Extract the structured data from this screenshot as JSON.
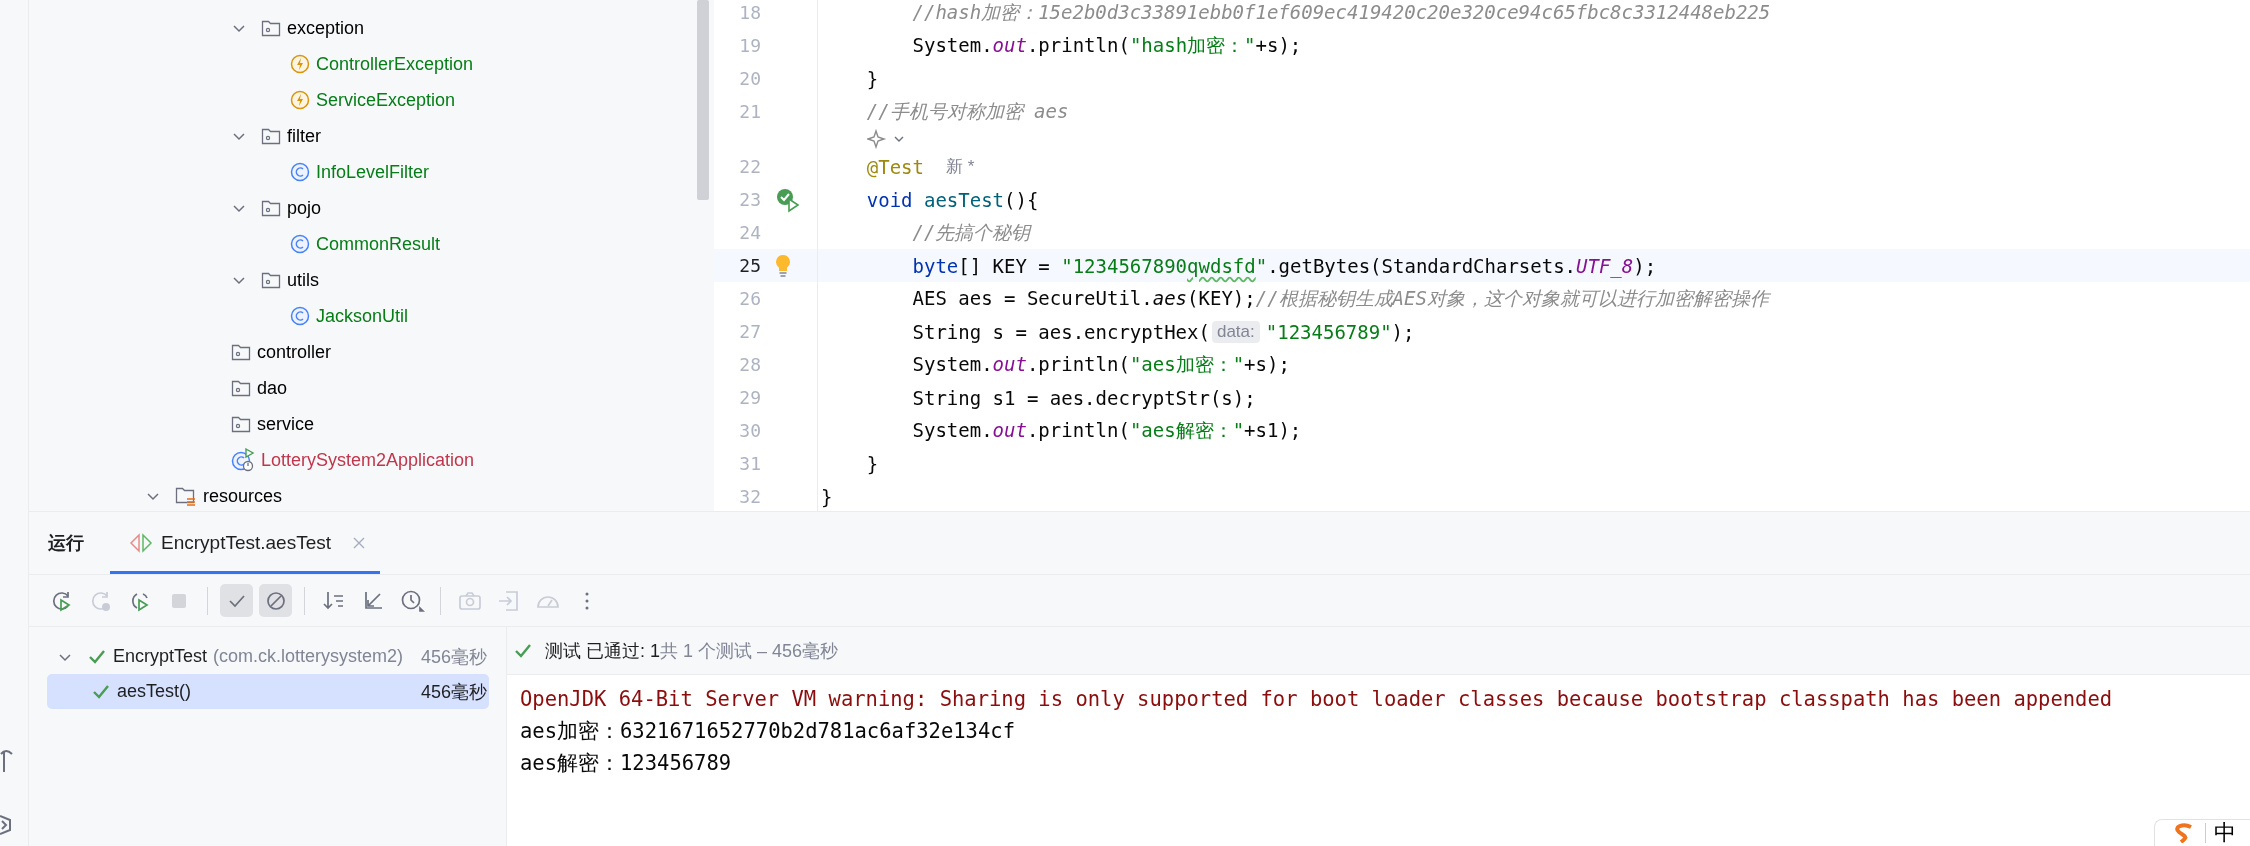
{
  "project_tree": {
    "items": [
      {
        "label": "exception",
        "kind": "package",
        "expanded": true,
        "children": [
          {
            "label": "ControllerException",
            "kind": "exception",
            "color": "#067d17"
          },
          {
            "label": "ServiceException",
            "kind": "exception",
            "color": "#067d17"
          }
        ]
      },
      {
        "label": "filter",
        "kind": "package",
        "expanded": true,
        "children": [
          {
            "label": "InfoLevelFilter",
            "kind": "class",
            "color": "#067d17"
          }
        ]
      },
      {
        "label": "pojo",
        "kind": "package",
        "expanded": true,
        "children": [
          {
            "label": "CommonResult",
            "kind": "class",
            "color": "#067d17"
          }
        ]
      },
      {
        "label": "utils",
        "kind": "package",
        "expanded": true,
        "children": [
          {
            "label": "JacksonUtil",
            "kind": "class",
            "color": "#067d17"
          }
        ]
      },
      {
        "label": "controller",
        "kind": "package"
      },
      {
        "label": "dao",
        "kind": "package"
      },
      {
        "label": "service",
        "kind": "package"
      },
      {
        "label": "LotterySystem2Application",
        "kind": "application",
        "color": "#c0364c"
      }
    ],
    "outer_items": [
      {
        "label": "resources",
        "kind": "resources",
        "expanded": true
      }
    ]
  },
  "editor": {
    "lines": [
      {
        "kind": "code",
        "number": "18",
        "current": false,
        "tokens": [
          {
            "text": "        //hash加密：15e2b0d3c33891ebb0f1ef609ec419420c20e320ce94c65fbc8c3312448eb225",
            "kind": "comment"
          }
        ]
      },
      {
        "kind": "code",
        "number": "19",
        "current": false,
        "tokens": [
          {
            "text": "        System.",
            "kind": "plain"
          },
          {
            "text": "out",
            "kind": "field"
          },
          {
            "text": ".println(",
            "kind": "plain"
          },
          {
            "text": "\"hash加密：\"",
            "kind": "string"
          },
          {
            "text": "+s);",
            "kind": "plain"
          }
        ]
      },
      {
        "kind": "code",
        "number": "20",
        "current": false,
        "tokens": [
          {
            "text": "    }",
            "kind": "plain"
          }
        ]
      },
      {
        "kind": "code",
        "number": "21",
        "current": false,
        "tokens": [
          {
            "text": "    //手机号对称加密 aes",
            "kind": "comment"
          }
        ]
      },
      {
        "kind": "ai_hint"
      },
      {
        "kind": "code",
        "number": "22",
        "current": false,
        "tokens": [
          {
            "text": "    @Test",
            "kind": "annotation"
          },
          {
            "text": "新 *",
            "kind": "author_hint"
          }
        ]
      },
      {
        "kind": "code",
        "number": "23",
        "current": false,
        "run_button": true,
        "bulb": false,
        "tokens": [
          {
            "text": "    void",
            "kind": "keyword"
          },
          {
            "text": " aesTest",
            "kind": "declaration"
          },
          {
            "text": "(){",
            "kind": "plain"
          }
        ]
      },
      {
        "kind": "code",
        "number": "24",
        "current": false,
        "tokens": [
          {
            "text": "        //先搞个秘钥",
            "kind": "comment"
          }
        ]
      },
      {
        "kind": "code",
        "number": "25",
        "current": true,
        "run_button": false,
        "bulb": true,
        "tokens": [
          {
            "text": "        byte",
            "kind": "keyword"
          },
          {
            "text": "[] KEY = ",
            "kind": "plain"
          },
          {
            "text": "\"1234567890",
            "kind": "string"
          },
          {
            "text": "qwdsfd",
            "kind": "string",
            "typo": true
          },
          {
            "text": "\"",
            "kind": "string"
          },
          {
            "text": ".getBytes(StandardCharsets.",
            "kind": "plain"
          },
          {
            "text": "UTF_8",
            "kind": "field"
          },
          {
            "text": ");",
            "kind": "plain"
          }
        ]
      },
      {
        "kind": "code",
        "number": "26",
        "current": false,
        "tokens": [
          {
            "text": "        AES aes = SecureUtil.",
            "kind": "plain"
          },
          {
            "text": "aes",
            "kind": "static"
          },
          {
            "text": "(KEY);",
            "kind": "plain"
          },
          {
            "text": "//根据秘钥生成AES对象，这个对象就可以进行加密解密操作",
            "kind": "comment"
          }
        ]
      },
      {
        "kind": "code",
        "number": "27",
        "current": false,
        "tokens": [
          {
            "text": "        String s = aes.encryptHex(",
            "kind": "plain"
          },
          {
            "text": "data:",
            "kind": "param_hint"
          },
          {
            "text": "\"123456789\"",
            "kind": "string"
          },
          {
            "text": ");",
            "kind": "plain"
          }
        ]
      },
      {
        "kind": "code",
        "number": "28",
        "current": false,
        "tokens": [
          {
            "text": "        System.",
            "kind": "plain"
          },
          {
            "text": "out",
            "kind": "field"
          },
          {
            "text": ".println(",
            "kind": "plain"
          },
          {
            "text": "\"aes加密：\"",
            "kind": "string"
          },
          {
            "text": "+s);",
            "kind": "plain"
          }
        ]
      },
      {
        "kind": "code",
        "number": "29",
        "current": false,
        "tokens": [
          {
            "text": "        String s1 = aes.decryptStr(s);",
            "kind": "plain"
          }
        ]
      },
      {
        "kind": "code",
        "number": "30",
        "current": false,
        "tokens": [
          {
            "text": "        System.",
            "kind": "plain"
          },
          {
            "text": "out",
            "kind": "field"
          },
          {
            "text": ".println(",
            "kind": "plain"
          },
          {
            "text": "\"aes解密：\"",
            "kind": "string"
          },
          {
            "text": "+s1);",
            "kind": "plain"
          }
        ]
      },
      {
        "kind": "code",
        "number": "31",
        "current": false,
        "tokens": [
          {
            "text": "    }",
            "kind": "plain"
          }
        ]
      },
      {
        "kind": "code",
        "number": "32",
        "current": false,
        "tokens": [
          {
            "text": "}",
            "kind": "plain"
          }
        ]
      }
    ]
  },
  "run_panel": {
    "title": "运行",
    "tabs": [
      {
        "label": "EncryptTest.aesTest",
        "selected": true
      }
    ],
    "toolbar": [
      {
        "buttons": [
          {
            "kind": "rerun",
            "disabled": false,
            "on": false
          },
          {
            "kind": "rerun_failed",
            "disabled": true,
            "on": false
          },
          {
            "kind": "auto_rerun",
            "disabled": false,
            "on": false
          },
          {
            "kind": "stop",
            "disabled": true,
            "on": false
          }
        ]
      },
      {
        "buttons": [
          {
            "kind": "show_passed",
            "disabled": false,
            "on": true
          },
          {
            "kind": "show_ignored",
            "disabled": false,
            "on": true
          }
        ]
      },
      {
        "buttons": [
          {
            "kind": "sort",
            "disabled": false,
            "on": false
          },
          {
            "kind": "collapse",
            "disabled": false,
            "on": false
          },
          {
            "kind": "history",
            "disabled": false,
            "on": false
          }
        ]
      },
      {
        "buttons": [
          {
            "kind": "snapshot",
            "disabled": true,
            "on": false
          },
          {
            "kind": "import",
            "disabled": true,
            "on": false
          },
          {
            "kind": "coverage",
            "disabled": true,
            "on": false
          },
          {
            "kind": "more",
            "disabled": false,
            "on": false
          }
        ]
      }
    ],
    "tests": [
      {
        "name": "EncryptTest",
        "package": "(com.ck.lotterysystem2)",
        "time": "456毫秒",
        "passed": true,
        "expanded": true,
        "selected": false,
        "children": [
          {
            "name": "aesTest()",
            "time": "456毫秒",
            "passed": true,
            "selected": true
          }
        ]
      }
    ],
    "result": {
      "passed": true,
      "label": "测试 已通过: 1",
      "summary": "共 1 个测试 – 456毫秒"
    },
    "output": [
      {
        "kind": "stderr",
        "text": "OpenJDK 64-Bit Server VM warning: Sharing is only supported for boot loader classes because bootstrap classpath has been appended"
      },
      {
        "kind": "stdout",
        "text": "aes加密：6321671652770b2d781ac6af32e134cf"
      },
      {
        "kind": "stdout",
        "text": "aes解密：123456789"
      }
    ]
  },
  "ime_widget": {
    "label": "中"
  }
}
